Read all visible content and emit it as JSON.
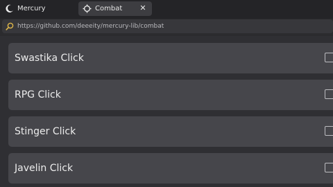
{
  "tabs": [
    {
      "label": "Mercury",
      "icon": "moon-icon",
      "active": false
    },
    {
      "label": "Combat",
      "icon": "crosshair-icon",
      "active": true
    }
  ],
  "address_bar": {
    "url": "https://github.com/deeeity/mercury-lib/combat",
    "icon": "search-icon"
  },
  "items": [
    {
      "label": "Swastika Click",
      "checked": false
    },
    {
      "label": "RPG Click",
      "checked": false
    },
    {
      "label": "Stinger Click",
      "checked": false
    },
    {
      "label": "Javelin Click",
      "checked": false
    }
  ],
  "colors": {
    "background": "#2b2b2e",
    "tab_active": "#3d3d41",
    "item_background": "#46464b",
    "search_icon": "#e0b84a"
  }
}
